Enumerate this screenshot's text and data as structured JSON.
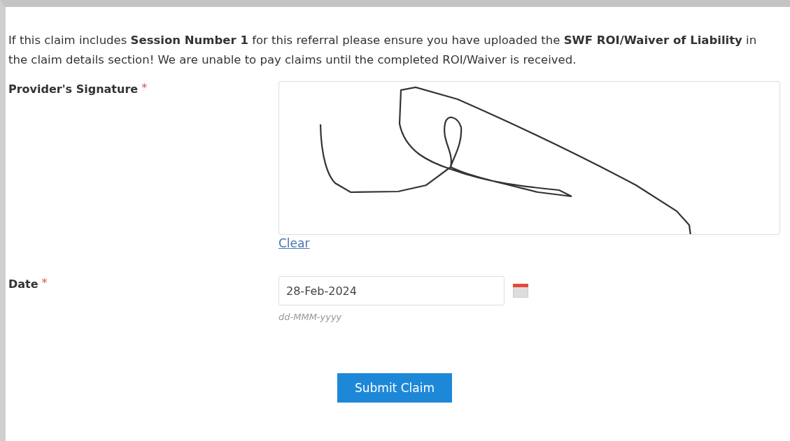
{
  "notice": "If this claim includes **Session Number 1** for this referral please ensure you have uploaded the **SWF ROI/Waiver of Liability** in the claim details section! We are unable to pay claims until the completed ROI/Waiver is received.",
  "signature": {
    "label": "Provider's Signature",
    "required_mark": "*",
    "clear_link": "Clear"
  },
  "date": {
    "label": "Date",
    "required_mark": "*",
    "value": "28-Feb-2024",
    "format_hint": "dd-MMM-yyyy"
  },
  "submit_button": "Submit Claim"
}
